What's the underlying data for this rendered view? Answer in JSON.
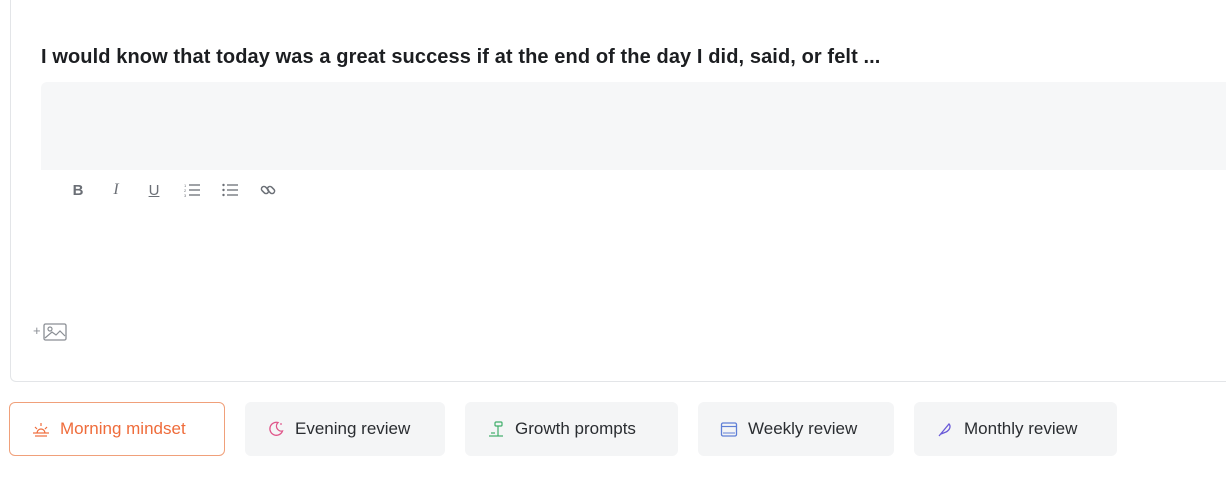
{
  "prompt": {
    "title": "I would know that today was a great success if at the end of the day I did, said, or felt ..."
  },
  "editor": {
    "answer_value": "",
    "toolbar": {
      "bold_label": "B",
      "italic_label": "I",
      "underline_label": "U",
      "ordered_list_icon": "ordered-list-icon",
      "bullet_list_icon": "bullet-list-icon",
      "link_icon": "link-icon"
    },
    "add_image": {
      "plus": "+",
      "icon": "image-icon"
    }
  },
  "tabs": [
    {
      "label": "Morning mindset",
      "icon": "sunrise-icon",
      "active": true,
      "color": "#ef6c3b"
    },
    {
      "label": "Evening review",
      "icon": "moon-icon",
      "active": false,
      "color": "#e0568a"
    },
    {
      "label": "Growth prompts",
      "icon": "sprout-icon",
      "active": false,
      "color": "#3fae6a"
    },
    {
      "label": "Weekly review",
      "icon": "calendar-icon",
      "active": false,
      "color": "#5f7fd6"
    },
    {
      "label": "Monthly review",
      "icon": "feather-icon",
      "active": false,
      "color": "#6a5ad8"
    }
  ],
  "colors": {
    "accent": "#ef6c3b",
    "answer_bg": "#f6f7f8",
    "tab_bg": "#f4f5f6"
  }
}
